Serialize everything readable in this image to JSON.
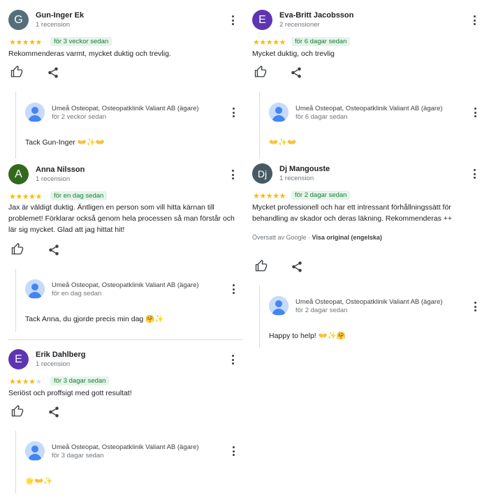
{
  "reviews_left": [
    {
      "initial": "G",
      "avatar_color": "#546e7a",
      "name": "Gun-Inger Ek",
      "sub": "1 recension",
      "stars": "★★★★★",
      "stars_off": "",
      "time": "för 3 veckor sedan",
      "text": "Rekommenderas varmt, mycket duktig och trevlig.",
      "reply": {
        "owner": "Umeå Osteopat, Osteopatklinik Valiant AB (ägare)",
        "time": "för 2 veckor sedan",
        "text": "Tack Gun-Inger 👐✨👐"
      }
    },
    {
      "initial": "A",
      "avatar_color": "#33691e",
      "name": "Anna Nilsson",
      "sub": "1 recension",
      "stars": "★★★★★",
      "stars_off": "",
      "time": "för en dag sedan",
      "text_lines": [
        "Jax är väldigt duktig. Äntligen en person som vill hitta kärnan till",
        "problemet! Förklarar också genom hela processen så man förstår och",
        "lär sig mycket. Glad att jag hittat hit!"
      ],
      "reply": {
        "owner": "Umeå Osteopat, Osteopatklinik Valiant AB (ägare)",
        "time": "för en dag sedan",
        "text": "Tack Anna, du gjorde precis min dag 🤗✨"
      }
    },
    {
      "initial": "E",
      "avatar_color": "#5e35b1",
      "name": "Erik Dahlberg",
      "sub": "1 recension",
      "stars": "★★★★",
      "stars_off": "★",
      "time": "för 3 dagar sedan",
      "text": "Seriöst och proffsigt med gott resultat!",
      "reply": {
        "owner": "Umeå Osteopat, Osteopatklinik Valiant AB (ägare)",
        "time": "för 3 dagar sedan",
        "text": "🌟👐✨"
      }
    }
  ],
  "reviews_right": [
    {
      "initial": "E",
      "avatar_color": "#5e35b1",
      "name": "Eva-Britt Jacobsson",
      "sub": "2 recensioner",
      "stars": "★★★★★",
      "stars_off": "",
      "time": "för 6 dagar sedan",
      "text": "Mycket duktig, och trevlig",
      "reply": {
        "owner": "Umeå Osteopat, Osteopatklinik Valiant AB (ägare)",
        "time": "för 6 dagar sedan",
        "text": "👐✨👐"
      }
    },
    {
      "initial": "Dj",
      "avatar_color": "#455a64",
      "name": "Dj Mangouste",
      "sub": "1 recension",
      "stars": "★★★★★",
      "stars_off": "",
      "time": "för 2 dagar sedan",
      "text_lines": [
        "Mycket professionell och har ett intressant förhållningssätt för",
        "behandling av skador och deras läkning. Rekommenderas ++"
      ],
      "translated_prefix": "Översatt av Google · ",
      "translated_link": "Visa original (engelska)",
      "reply": {
        "owner": "Umeå Osteopat, Osteopatklinik Valiant AB (ägare)",
        "time": "för 2 dagar sedan",
        "text": "Happy to help! 👐✨🤗"
      }
    }
  ],
  "icons": {
    "like": "thumb-up-icon",
    "share": "share-icon",
    "more": "more-vert-icon"
  }
}
